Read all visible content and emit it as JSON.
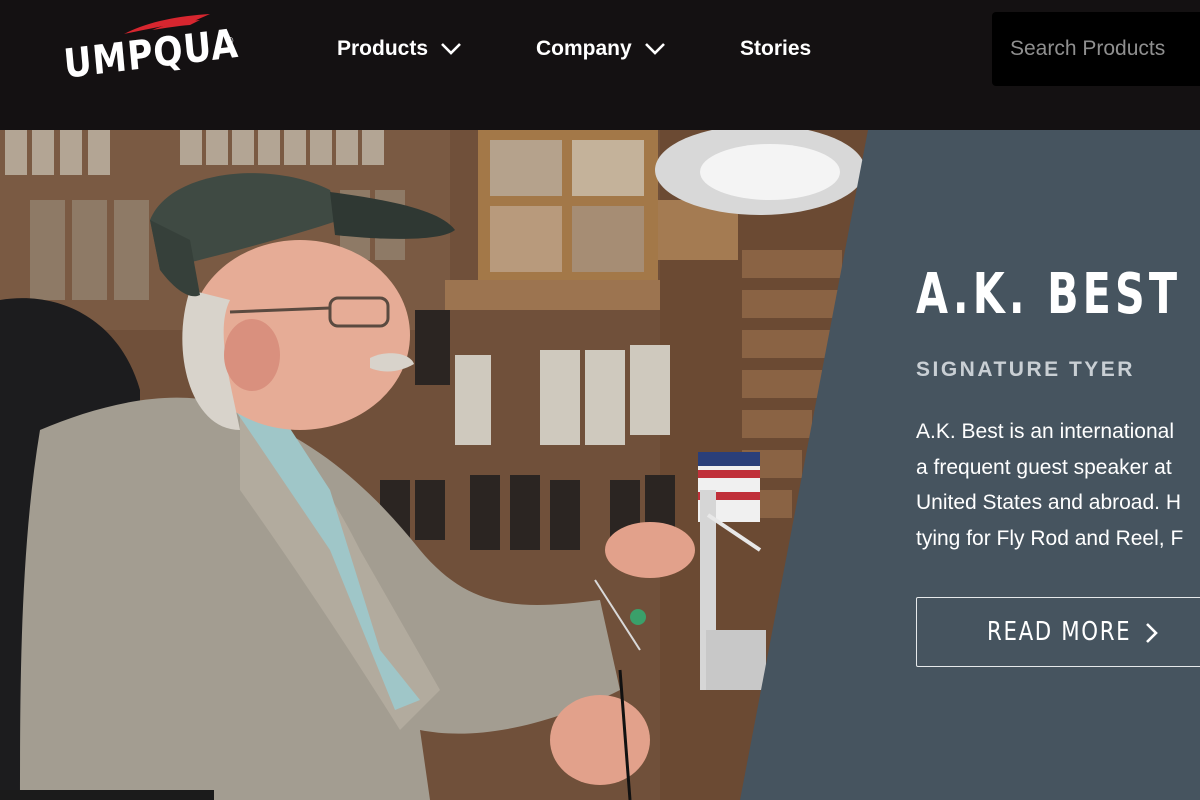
{
  "header": {
    "logo_text": "UMPQUA",
    "logo_mark": "®",
    "nav": [
      {
        "label": "Products",
        "icon": "chevron-down-icon"
      },
      {
        "label": "Company",
        "icon": "chevron-down-icon"
      },
      {
        "label": "Stories"
      }
    ],
    "search": {
      "placeholder": "Search Products",
      "value": ""
    }
  },
  "hero": {
    "title": "A.K. BEST",
    "subtitle": "SIGNATURE TYER",
    "body_lines": [
      "A.K. Best is an international",
      "a frequent guest speaker at",
      "United States and abroad. H",
      "tying for Fly Rod and Reel, F"
    ],
    "cta_label": "READ MORE",
    "cta_icon": "chevron-right-icon"
  },
  "colors": {
    "header_bg": "#141112",
    "panel_bg": "#46545f",
    "logo_accent": "#d7262f",
    "subtitle": "#c9cfd4"
  }
}
